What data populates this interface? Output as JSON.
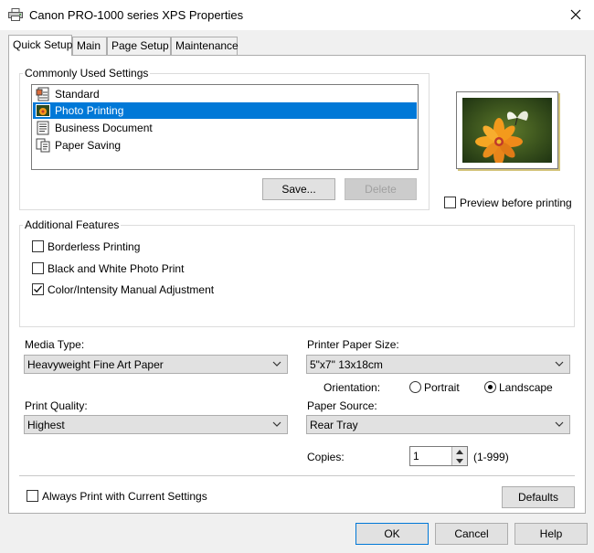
{
  "window": {
    "title": "Canon PRO-1000 series XPS Properties"
  },
  "tabs": [
    {
      "label": "Quick Setup",
      "active": true
    },
    {
      "label": "Main"
    },
    {
      "label": "Page Setup"
    },
    {
      "label": "Maintenance"
    }
  ],
  "commonly_used": {
    "group_label": "Commonly Used Settings",
    "items": [
      {
        "label": "Standard",
        "icon": "document-settings-icon"
      },
      {
        "label": "Photo Printing",
        "icon": "photo-flower-icon",
        "selected": true
      },
      {
        "label": "Business Document",
        "icon": "business-document-icon"
      },
      {
        "label": "Paper Saving",
        "icon": "paper-saving-icon"
      }
    ],
    "save_label": "Save...",
    "delete_label": "Delete"
  },
  "preview": {
    "checkbox_label": "Preview before printing",
    "checked": false
  },
  "additional_features": {
    "group_label": "Additional Features",
    "options": [
      {
        "label": "Borderless Printing",
        "checked": false
      },
      {
        "label": "Black and White Photo Print",
        "checked": false
      },
      {
        "label": "Color/Intensity Manual Adjustment",
        "checked": true
      }
    ]
  },
  "media_type": {
    "label": "Media Type:",
    "value": "Heavyweight Fine Art Paper"
  },
  "paper_size": {
    "label": "Printer Paper Size:",
    "value": "5\"x7\" 13x18cm"
  },
  "orientation": {
    "label": "Orientation:",
    "portrait_label": "Portrait",
    "landscape_label": "Landscape",
    "selected": "Landscape"
  },
  "print_quality": {
    "label": "Print Quality:",
    "value": "Highest"
  },
  "paper_source": {
    "label": "Paper Source:",
    "value": "Rear Tray"
  },
  "copies": {
    "label": "Copies:",
    "value": "1",
    "range": "(1-999)"
  },
  "always_print": {
    "label": "Always Print with Current Settings",
    "checked": false
  },
  "buttons": {
    "defaults": "Defaults",
    "ok": "OK",
    "cancel": "Cancel",
    "help": "Help"
  },
  "colors": {
    "selection": "#0078d7",
    "window_bg": "#f0f0f0",
    "panel_bg": "#ffffff"
  }
}
